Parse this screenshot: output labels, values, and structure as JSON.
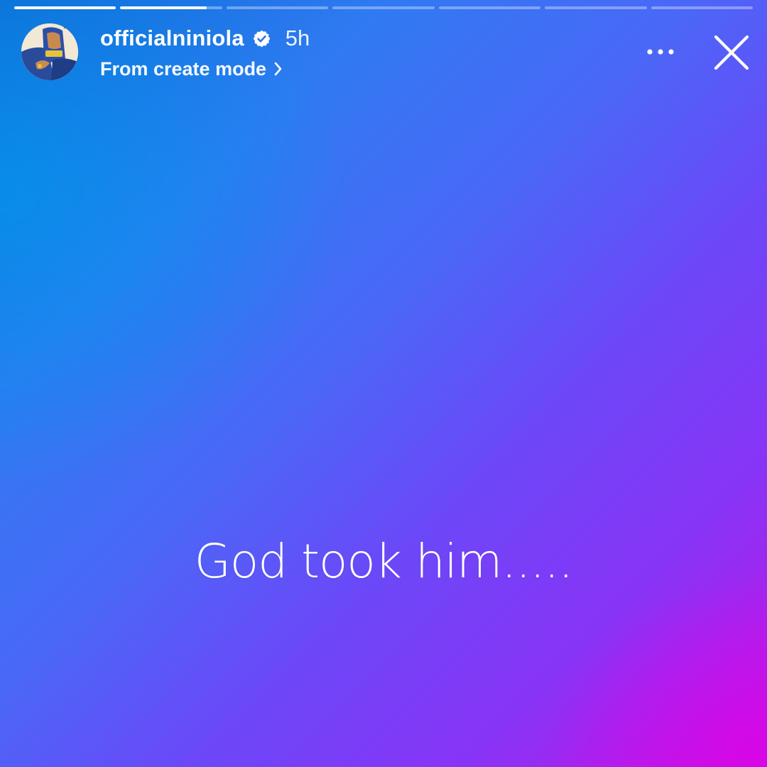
{
  "story": {
    "progress_segments": [
      1,
      0.85,
      0,
      0,
      0,
      0,
      0
    ],
    "background_colors": [
      "#0096eb",
      "#3078f2",
      "#6b48f8",
      "#8834f6",
      "#c512e6"
    ]
  },
  "header": {
    "username": "officialniniola",
    "verified": true,
    "time_ago": "5h",
    "subtitle": "From create mode",
    "avatar_icon": "profile-avatar",
    "more_icon": "ellipsis-icon",
    "close_icon": "close-icon"
  },
  "caption": {
    "text": "God took him....."
  }
}
